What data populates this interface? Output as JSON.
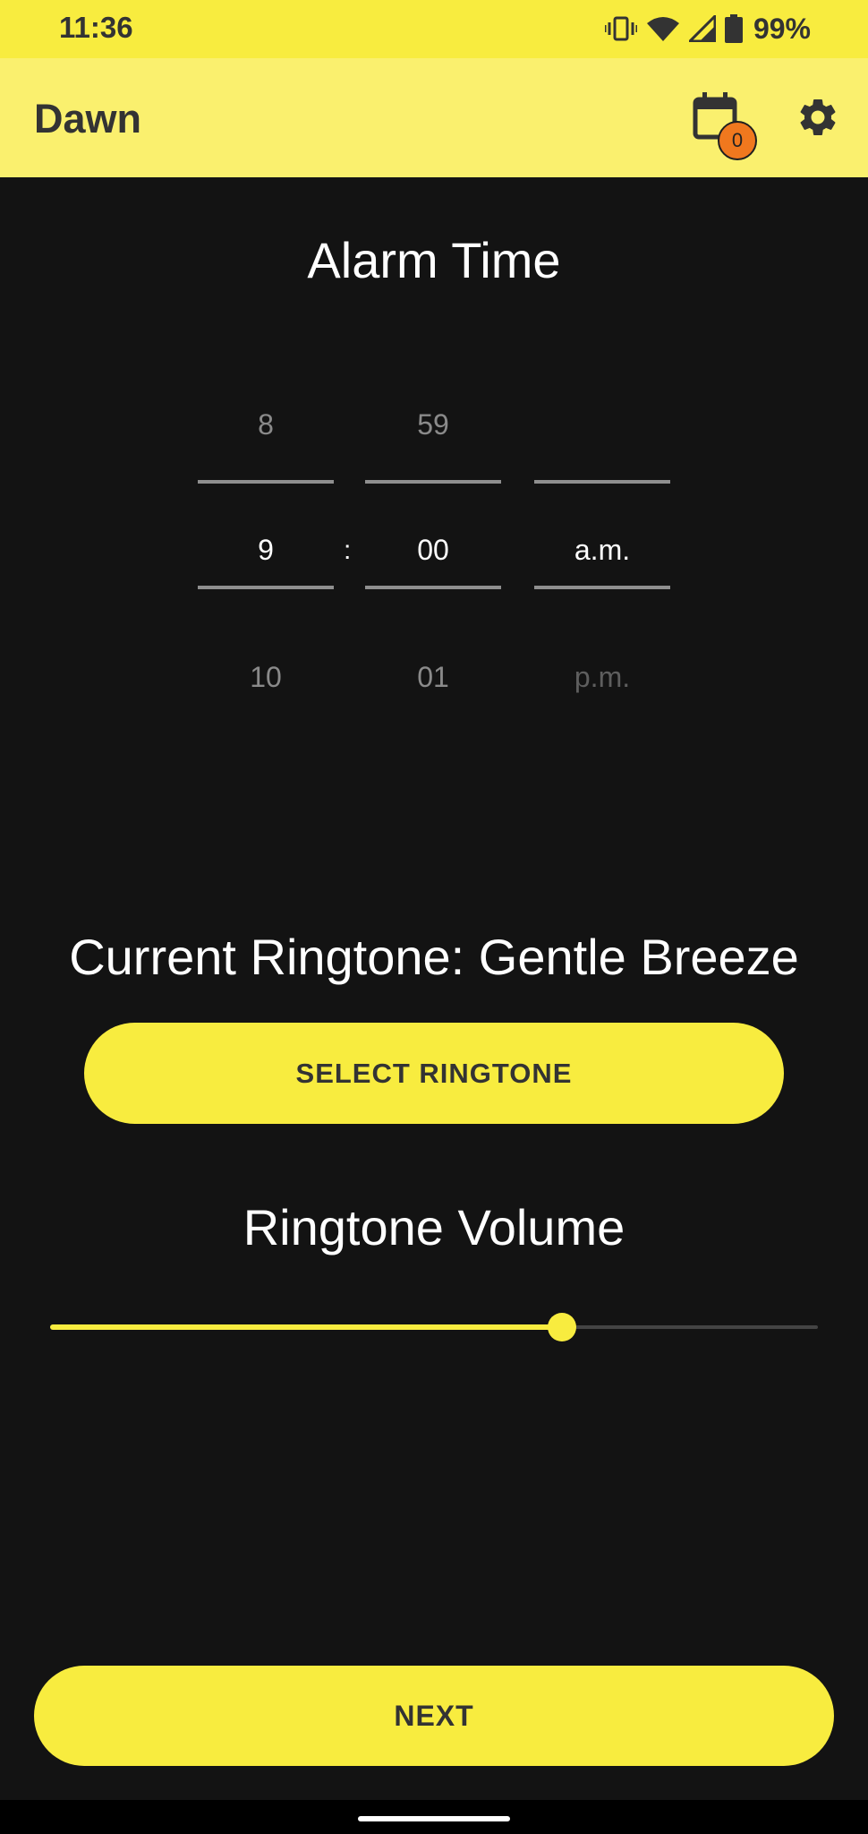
{
  "status_bar": {
    "time": "11:36",
    "battery_percent": "99%",
    "icons": [
      "vibrate-icon",
      "wifi-icon",
      "signal-icon",
      "battery-icon"
    ]
  },
  "app_bar": {
    "title": "Dawn",
    "calendar_badge_count": "0",
    "icons": [
      "calendar-icon",
      "gear-icon"
    ]
  },
  "alarm": {
    "title": "Alarm Time",
    "separator": ":",
    "hour": {
      "prev": "8",
      "selected": "9",
      "next": "10"
    },
    "minute": {
      "prev": "59",
      "selected": "00",
      "next": "01"
    },
    "period": {
      "prev": "",
      "selected": "a.m.",
      "next": "p.m."
    }
  },
  "ringtone": {
    "label": "Current Ringtone: Gentle Breeze",
    "select_button": "SELECT RINGTONE"
  },
  "volume": {
    "label": "Ringtone Volume",
    "level_fraction": 0.667
  },
  "footer": {
    "next_button": "NEXT"
  },
  "colors": {
    "accent": "#f8ec3f",
    "app_bar": "#faf06e",
    "background": "#131313",
    "badge": "#f0781e"
  }
}
